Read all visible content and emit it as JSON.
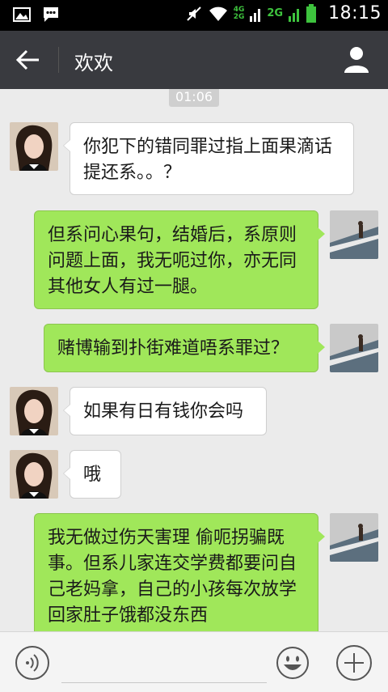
{
  "status_bar": {
    "time": "18:15",
    "network_top": "4G",
    "network_bottom": "2G",
    "network_main": "2G"
  },
  "header": {
    "title": "欢欢"
  },
  "timestamp": "01:06",
  "messages": [
    {
      "side": "left",
      "text": "你犯下的错同罪过指上面果滴话提还系。。？"
    },
    {
      "side": "right",
      "text": "但系问心果句，结婚后，系原则问题上面，我无呃过你，亦无同其他女人有过一腿。"
    },
    {
      "side": "right",
      "text": "赌博输到扑街难道唔系罪过？"
    },
    {
      "side": "left",
      "text": "如果有日有钱你会吗"
    },
    {
      "side": "left",
      "text": "哦"
    },
    {
      "side": "right",
      "text": "我无做过伤天害理 偷呃拐骗既事。但系儿家连交学费都要问自己老妈拿，自己的小孩每次放学回家肚子饿都没东西"
    }
  ],
  "input": {
    "placeholder": ""
  },
  "colors": {
    "header_bg": "#393a3f",
    "chat_bg": "#ebebeb",
    "sent_bubble": "#a0e75a",
    "received_bubble": "#ffffff",
    "signal_green": "#3ec33e"
  },
  "icons": {
    "back": "arrow-left-icon",
    "profile": "person-icon",
    "voice": "voice-icon",
    "emoji": "smiley-icon",
    "more": "plus-icon"
  }
}
